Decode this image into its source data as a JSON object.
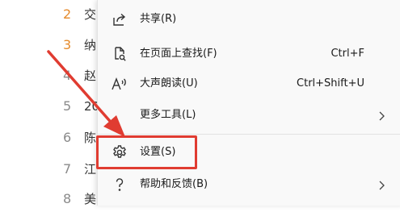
{
  "background_list": [
    {
      "num": "2",
      "text": "交",
      "num_color": "#e58a2b"
    },
    {
      "num": "3",
      "text": "纳",
      "num_color": "#e58a2b"
    },
    {
      "num": "4",
      "text": "赵",
      "num_color": "#8a8a8a"
    },
    {
      "num": "5",
      "text": "20",
      "num_color": "#8a8a8a"
    },
    {
      "num": "6",
      "text": "陈",
      "num_color": "#8a8a8a"
    },
    {
      "num": "7",
      "text": "江",
      "num_color": "#8a8a8a"
    },
    {
      "num": "8",
      "text": "美",
      "num_color": "#8a8a8a"
    }
  ],
  "menu": {
    "items": [
      {
        "label": "共享(R)",
        "shortcut": "",
        "icon": "share-icon",
        "has_submenu": false
      },
      {
        "label": "在页面上查找(F)",
        "shortcut": "Ctrl+F",
        "icon": "find-on-page-icon",
        "has_submenu": false
      },
      {
        "label": "大声朗读(U)",
        "shortcut": "Ctrl+Shift+U",
        "icon": "read-aloud-icon",
        "has_submenu": false
      },
      {
        "label": "更多工具(L)",
        "shortcut": "",
        "icon": "",
        "has_submenu": true
      },
      {
        "label": "设置(S)",
        "shortcut": "",
        "icon": "gear-icon",
        "has_submenu": false
      },
      {
        "label": "帮助和反馈(B)",
        "shortcut": "",
        "icon": "help-icon",
        "has_submenu": true
      }
    ]
  },
  "annotation": {
    "highlight_color": "#e03c31",
    "arrow_color": "#e03c31"
  }
}
